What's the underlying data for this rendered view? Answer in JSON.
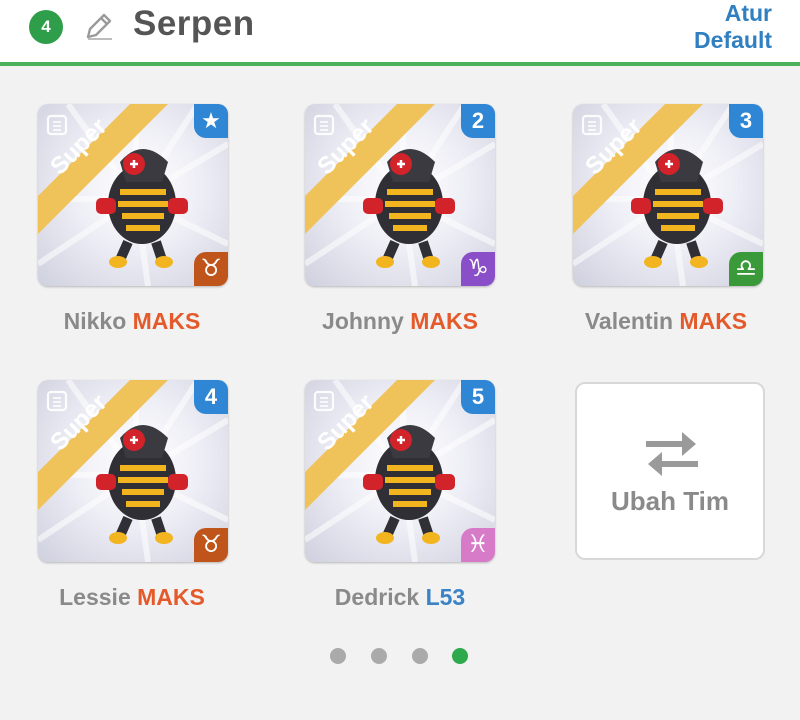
{
  "header": {
    "team_number": "4",
    "team_name": "Serpen",
    "reset_label_line1": "Atur",
    "reset_label_line2": "Default"
  },
  "cards": [
    {
      "tag": "Super",
      "badge": "★",
      "zodiac": "♉",
      "zodiac_color": "#c0551b",
      "name": "Nikko",
      "level": "MAKS"
    },
    {
      "tag": "Super",
      "badge": "2",
      "zodiac": "♑",
      "zodiac_color": "#8a4fc8",
      "name": "Johnny",
      "level": "MAKS"
    },
    {
      "tag": "Super",
      "badge": "3",
      "zodiac": "♎",
      "zodiac_color": "#3a9a3a",
      "name": "Valentin",
      "level": "MAKS"
    },
    {
      "tag": "Super",
      "badge": "4",
      "zodiac": "♉",
      "zodiac_color": "#c0551b",
      "name": "Lessie",
      "level": "MAKS"
    },
    {
      "tag": "Super",
      "badge": "5",
      "zodiac": "♓",
      "zodiac_color": "#d77bc9",
      "name": "Dedrick",
      "level": "L53"
    }
  ],
  "swap": {
    "label": "Ubah Tim"
  },
  "pagination": {
    "count": 4,
    "active": 4
  },
  "colors": {
    "accent_green": "#4caf5a",
    "link_blue": "#2f7fc1",
    "level_orange": "#e45a2a",
    "level_blue": "#3a83c6"
  }
}
